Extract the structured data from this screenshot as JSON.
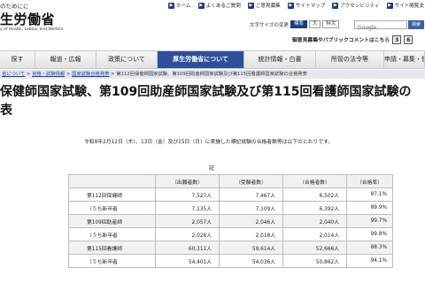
{
  "header": {
    "lead_text": "のためにに",
    "top_links": [
      {
        "label": "ホーム",
        "icon": "home-arrow-icon"
      },
      {
        "label": "よくあるご質問",
        "icon": "faq-arrow-icon"
      },
      {
        "label": "ご意見募集",
        "icon": "opinion-arrow-icon"
      },
      {
        "label": "サイトマップ",
        "icon": "sitemap-arrow-icon"
      },
      {
        "label": "アクセシビリティ",
        "icon": "accessibility-arrow-icon"
      },
      {
        "label": "サイト閲覧支",
        "icon": "browse-support-arrow-icon"
      }
    ],
    "logo_jp": "生労働省",
    "logo_en": "y of Health, Labour and Welfare",
    "font_size_label": "文字サイズの変更",
    "font_size_buttons": [
      "標準",
      "大",
      "特大"
    ],
    "search_button": "検索",
    "google_label": "Google",
    "opinion_text": "御意見募集やパブリックコメントはこちら",
    "opinion_digits": [
      "3",
      "6"
    ]
  },
  "nav": {
    "items": [
      "探す",
      "報道・広報",
      "政策について",
      "厚生労働省について",
      "統計情報・白書",
      "所管の法令等",
      "申請・募集・情"
    ],
    "active_index": 3
  },
  "breadcrumb": {
    "items": [
      "省について",
      "資格・試験情報",
      "国家試験合格発表",
      "第112回保健師国家試験、第109回助産師国家試験及び第115回看護師国家試験の合格発表"
    ],
    "separator": " > "
  },
  "main": {
    "title": "保健師国家試験、第109回助産師国家試験及び第115回看護師国家試験の",
    "title_line2": "表",
    "date_note": "令和8年2月12日（木）、13日（金）及び15日（日）に実施した標記試験の合格者数等は以下のとおりです。",
    "ki_label": "記"
  },
  "table": {
    "headers": [
      "",
      "（出願者数）",
      "（受験者数）",
      "（合格者数）",
      "（合格率）"
    ],
    "rows": [
      {
        "label": "第112回保健師",
        "applicants": "7,527人",
        "examinees": "7,467人",
        "passers": "6,502人",
        "rate": "87.1%",
        "shade": false
      },
      {
        "label": "（うち新卒者",
        "applicants": "7,135人",
        "examinees": "7,109人",
        "passers": "6,392人",
        "rate": "89.9%",
        "shade": false
      },
      {
        "label": "第109回助産師",
        "applicants": "2,057人",
        "examinees": "2,046人",
        "passers": "2,040人",
        "rate": "99.7%",
        "shade": true
      },
      {
        "label": "（うち新卒者",
        "applicants": "2,028人",
        "examinees": "2,018人",
        "passers": "2,014人",
        "rate": "99.8%",
        "shade": false
      },
      {
        "label": "第115回看護師",
        "applicants": "60,311人",
        "examinees": "59,614人",
        "passers": "52,666人",
        "rate": "88.3%",
        "shade": true
      },
      {
        "label": "（うち新卒者",
        "applicants": "54,401人",
        "examinees": "54,036人",
        "passers": "50,862人",
        "rate": "94.1%",
        "shade": false
      }
    ]
  },
  "colors": {
    "nav_active": "#2d4f9c",
    "link": "#1a3c9c",
    "breadcrumb_bg": "#e4e9f1"
  }
}
